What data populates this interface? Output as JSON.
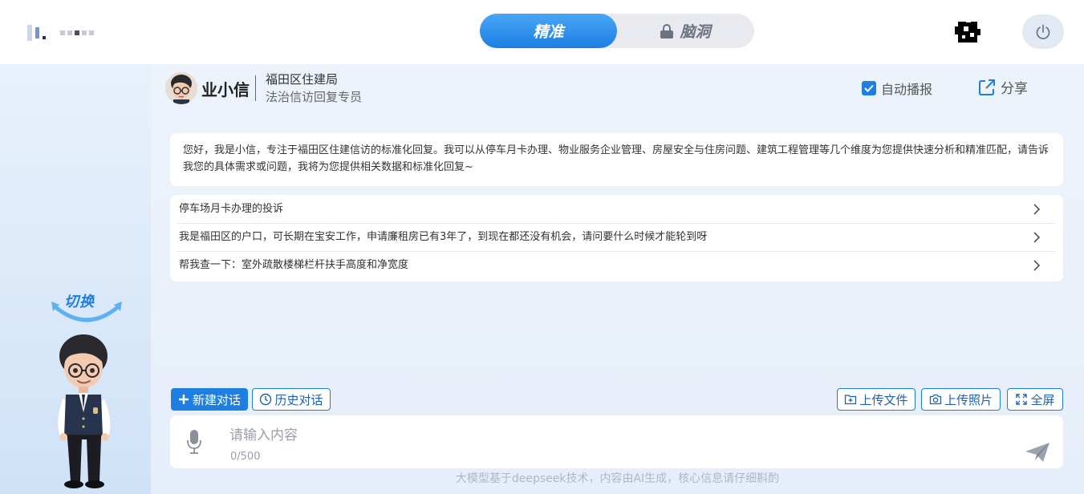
{
  "header": {
    "logo_text": "",
    "mode_active_label": "精准",
    "mode_inactive_label": "脑洞"
  },
  "sidebar": {
    "switch_label": "切换"
  },
  "agent": {
    "name": "业小信",
    "org": "福田区住建局",
    "role": "法治信访回复专员",
    "auto_play_label": "自动播报",
    "auto_play_checked": true,
    "share_label": "分享"
  },
  "greeting": "您好，我是小信，专注于福田区住建信访的标准化回复。我可以从停车月卡办理、物业服务企业管理、房屋安全与住房问题、建筑工程管理等几个维度为您提供快速分析和精准匹配，请告诉我您的具体需求或问题，我将为您提供相关数据和标准化回复~",
  "suggestions": [
    "停车场月卡办理的投诉",
    "我是福田区的户口，可长期在宝安工作，申请廉租房已有3年了，到现在都还没有机会，请问要什么时候才能轮到呀",
    "帮我查一下：室外疏散楼梯栏杆扶手高度和净宽度"
  ],
  "toolbar": {
    "new_chat": "新建对话",
    "history": "历史对话",
    "upload_file": "上传文件",
    "upload_photo": "上传照片",
    "fullscreen": "全屏"
  },
  "input": {
    "placeholder": "请输入内容",
    "char_count": "0/500"
  },
  "footer": "大模型基于deepseek技术，内容由AI生成，核心信息请仔细斟酌",
  "colors": {
    "accent": "#1f7fe0",
    "panel_bg": "#e6eef9"
  }
}
